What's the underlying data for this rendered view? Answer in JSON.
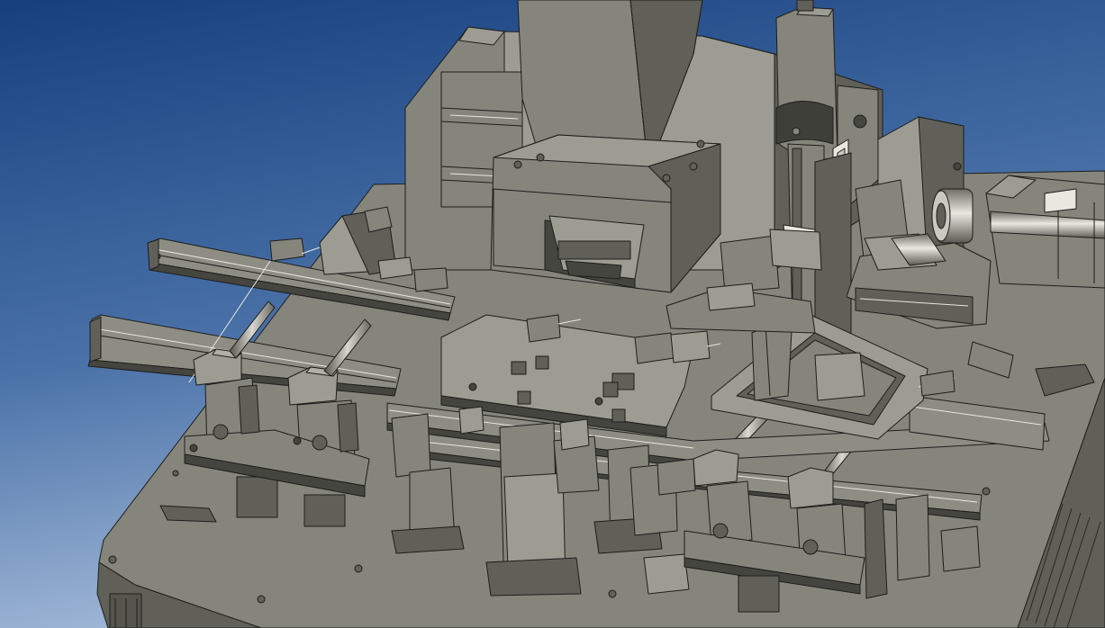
{
  "viewport": {
    "background": {
      "top": "#173f7e",
      "mid": "#4a72a8",
      "bottom": "#a9bedb"
    }
  },
  "palette": {
    "steel_light": "#9c9c92",
    "steel": "#85857c",
    "steel_dark": "#606058",
    "steel_shadow": "#45453f",
    "edge": "#1e1e1c",
    "rail": "#8d8d84",
    "highlight": "#e8e8e0",
    "chrome": "#c9c9c1"
  },
  "model": {
    "components": [
      "base-plate",
      "vertical-column",
      "press-head",
      "linear-actuator",
      "servo-motor",
      "left-feed-rails",
      "right-conveyor-rails",
      "center-fixture-plate",
      "rectangular-frame",
      "suction-nozzles",
      "clamp-blocks",
      "support-brackets"
    ]
  }
}
